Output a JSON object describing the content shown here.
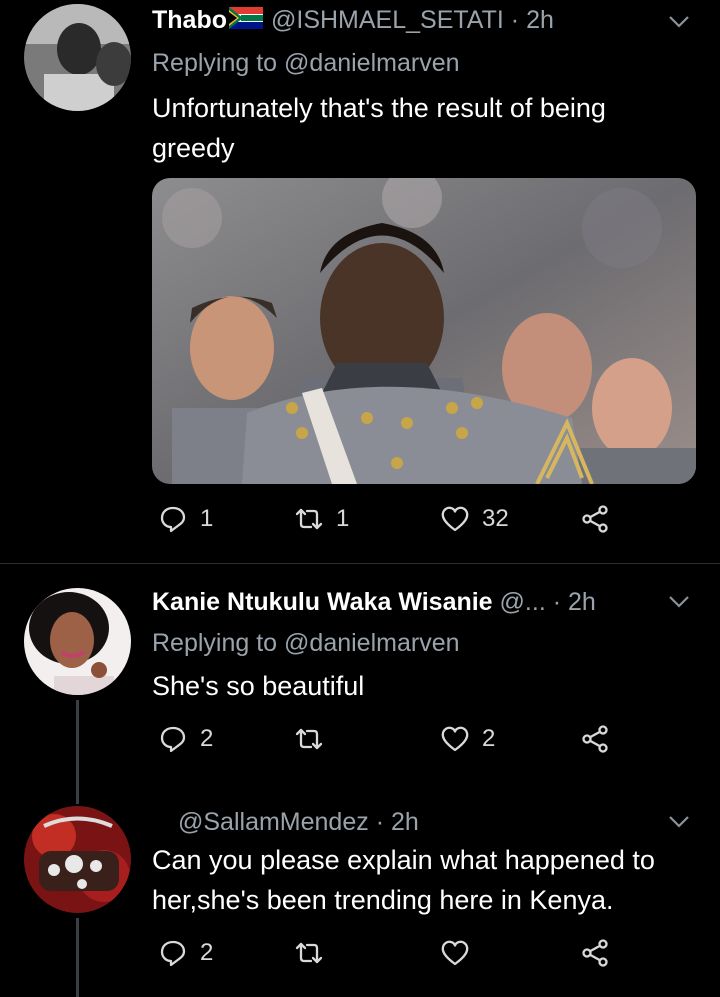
{
  "tweets": [
    {
      "name": "Thabo",
      "handle": "@ISHMAEL_SETATI",
      "time": "· 2h",
      "reply_prefix": "Replying to",
      "reply_to": "@danielmarven",
      "text": "Unfortunately that's the result of being greedy",
      "reply_count": "1",
      "retweet_count": "1",
      "like_count": "32"
    },
    {
      "name": "Kanie Ntukulu Waka Wisanie",
      "handle": "@...",
      "time": "· 2h",
      "reply_prefix": "Replying to",
      "reply_to": "@danielmarven",
      "text": "She's so beautiful",
      "reply_count": "2",
      "retweet_count": "",
      "like_count": "2"
    },
    {
      "name": "",
      "handle": "@SallamMendez",
      "time": "· 2h",
      "text": "Can you please explain what happened to her,she's been trending here in Kenya.",
      "reply_count": "2",
      "retweet_count": "",
      "like_count": ""
    }
  ],
  "colors": {
    "background": "#000000",
    "secondary_text": "#9aa3ab",
    "icon": "#d9d9d9"
  },
  "icons": [
    "chevron-down-icon",
    "reply-icon",
    "retweet-icon",
    "heart-icon",
    "share-icon",
    "south-africa-flag-icon"
  ]
}
